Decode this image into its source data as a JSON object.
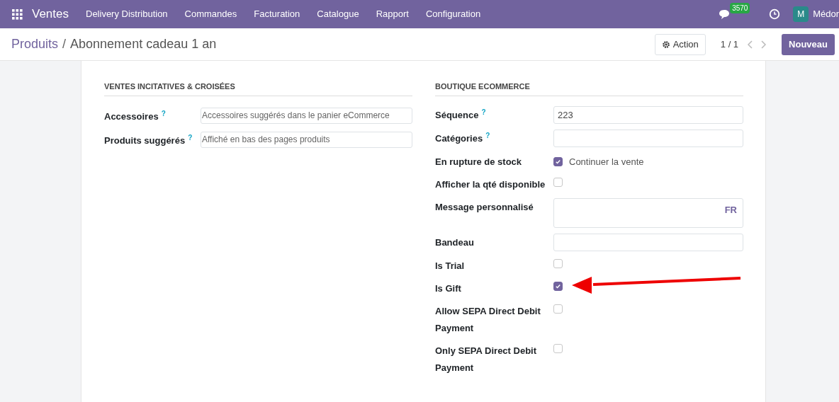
{
  "navbar": {
    "app": "Ventes",
    "menu": [
      "Delivery Distribution",
      "Commandes",
      "Facturation",
      "Catalogue",
      "Rapport",
      "Configuration"
    ],
    "messages_count": "3570",
    "avatar": "M",
    "user": "Médor"
  },
  "control_panel": {
    "breadcrumb": "Produits",
    "separator": "/",
    "title": "Abonnement cadeau 1 an",
    "action": "Action",
    "pager": "1 / 1",
    "new_button": "Nouveau"
  },
  "left_section": {
    "title": "VENTES INCITATIVES & CROISÉES",
    "fields": [
      {
        "label": "Accessoires",
        "help": "?",
        "placeholder": "Accessoires suggérés dans le panier eCommerce"
      },
      {
        "label": "Produits suggérés",
        "help": "?",
        "placeholder": "Affiché en bas des pages produits"
      }
    ]
  },
  "right_section": {
    "title": "BOUTIQUE ECOMMERCE",
    "fields": [
      {
        "kind": "input",
        "label": "Séquence",
        "help": "?",
        "value": "223"
      },
      {
        "kind": "input",
        "label": "Catégories",
        "help": "?"
      },
      {
        "kind": "checkbox",
        "label": "En rupture de stock",
        "checked": true,
        "option": "Continuer la vente"
      },
      {
        "kind": "checkbox",
        "label": "Afficher la qté disponible",
        "checked": false
      },
      {
        "kind": "textarea",
        "label": "Message personnalisé",
        "lang": "FR"
      },
      {
        "kind": "input",
        "label": "Bandeau"
      },
      {
        "kind": "checkbox",
        "label": "Is Trial",
        "checked": false
      },
      {
        "kind": "checkbox",
        "label": "Is Gift",
        "checked": true,
        "annotated": true
      },
      {
        "kind": "checkbox",
        "label": "Allow SEPA Direct Debit Payment",
        "checked": false
      },
      {
        "kind": "checkbox",
        "label": "Only SEPA Direct Debit Payment",
        "checked": false
      }
    ]
  }
}
